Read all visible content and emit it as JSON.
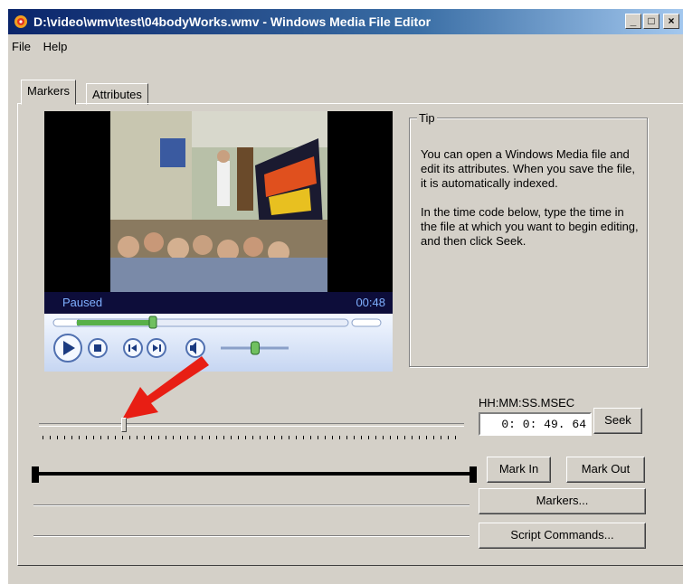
{
  "window": {
    "title": "D:\\video\\wmv\\test\\04bodyWorks.wmv - Windows Media File Editor",
    "minimize_glyph": "_",
    "maximize_glyph": "□",
    "close_glyph": "×"
  },
  "menu": [
    "File",
    "Help"
  ],
  "tabs": [
    "Markers",
    "Attributes"
  ],
  "player": {
    "status": "Paused",
    "time": "00:48",
    "seek_progress": 0.28,
    "volume_level": 0.5
  },
  "tip": {
    "title": "Tip",
    "paragraph1": "You can open a Windows Media file and edit its attributes. When you save the file, it is automatically indexed.",
    "paragraph2": "In the time code below, type the time in the file at which you want to begin editing, and then click Seek."
  },
  "timecode": {
    "label": "HH:MM:SS.MSEC",
    "value": "0:  0: 49.  64"
  },
  "buttons": {
    "seek": "Seek",
    "mark_in": "Mark In",
    "mark_out": "Mark Out",
    "markers": "Markers...",
    "script_commands": "Script Commands..."
  },
  "slider": {
    "position": 0.2
  },
  "colors": {
    "face": "#d4d0c8",
    "titlebar_start": "#0a246a",
    "annotation_arrow": "#e81e14"
  },
  "icons": [
    "app-icon",
    "play-icon",
    "stop-icon",
    "previous-icon",
    "next-icon",
    "mute-icon",
    "annotation-arrow"
  ]
}
